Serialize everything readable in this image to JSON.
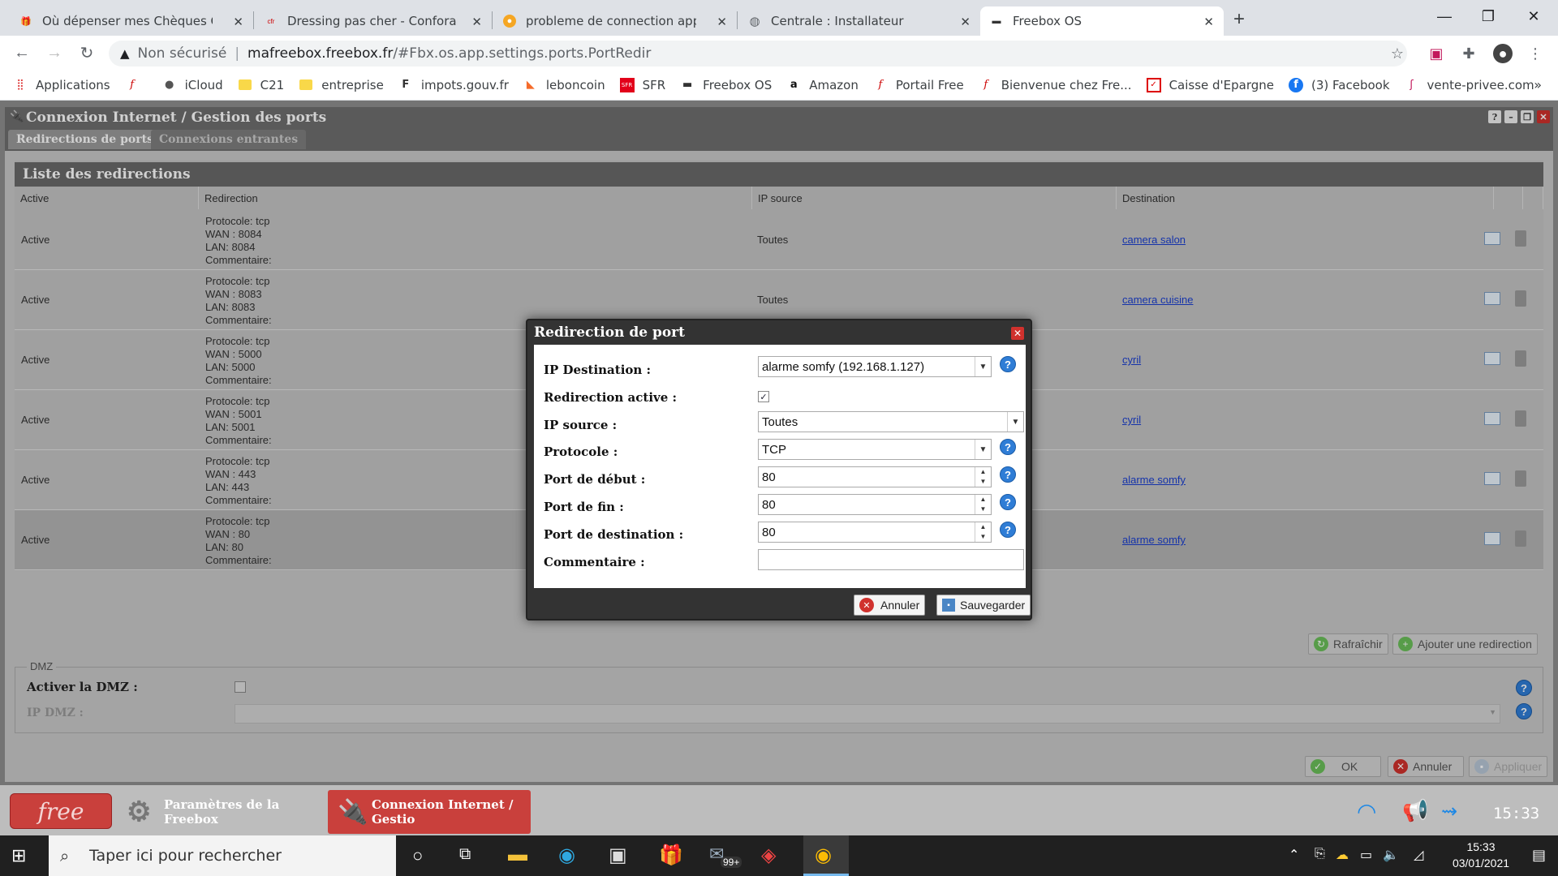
{
  "browser": {
    "tabs": [
      {
        "title": "Où dépenser mes Chèques Cade",
        "icon": "gift-icon"
      },
      {
        "title": "Dressing pas cher - Conforama –",
        "icon": "conforama-icon"
      },
      {
        "title": "probleme de connection applicat",
        "icon": "forum-icon"
      },
      {
        "title": "Centrale  : Installateur",
        "icon": "globe-icon"
      },
      {
        "title": "Freebox OS",
        "icon": "freebox-icon"
      }
    ],
    "address": {
      "security": "Non sécurisé",
      "host": "mafreebox.freebox.fr",
      "path": "/#Fbx.os.app.settings.ports.PortRedir"
    },
    "bookmarks": [
      "Applications",
      "iCloud",
      "C21",
      "entreprise",
      "impots.gouv.fr",
      "leboncoin",
      "SFR",
      "Freebox OS",
      "Amazon",
      "Portail Free",
      "Bienvenue chez Fre...",
      "Caisse d'Epargne",
      "(3) Facebook",
      "vente-privee.com"
    ],
    "more": "»"
  },
  "window": {
    "title": "Connexion Internet / Gestion des ports",
    "subtabs": [
      "Redirections de ports",
      "Connexions entrantes"
    ]
  },
  "list": {
    "title": "Liste des redirections",
    "columns": [
      "Active",
      "Redirection",
      "IP source",
      "Destination"
    ],
    "rows": [
      {
        "active": "Active",
        "proto": "Protocole: tcp",
        "wan": "WAN : 8084",
        "lan": "LAN: 8084",
        "comment": "Commentaire:",
        "src": "Toutes",
        "dest": "camera salon"
      },
      {
        "active": "Active",
        "proto": "Protocole: tcp",
        "wan": "WAN : 8083",
        "lan": "LAN: 8083",
        "comment": "Commentaire:",
        "src": "Toutes",
        "dest": "camera cuisine"
      },
      {
        "active": "Active",
        "proto": "Protocole: tcp",
        "wan": "WAN : 5000",
        "lan": "LAN: 5000",
        "comment": "Commentaire:",
        "src": "",
        "dest": "cyril"
      },
      {
        "active": "Active",
        "proto": "Protocole: tcp",
        "wan": "WAN : 5001",
        "lan": "LAN: 5001",
        "comment": "Commentaire:",
        "src": "",
        "dest": "cyril"
      },
      {
        "active": "Active",
        "proto": "Protocole: tcp",
        "wan": "WAN : 443",
        "lan": "LAN: 443",
        "comment": "Commentaire:",
        "src": "",
        "dest": "alarme somfy"
      },
      {
        "active": "Active",
        "proto": "Protocole: tcp",
        "wan": "WAN : 80",
        "lan": "LAN: 80",
        "comment": "Commentaire:",
        "src": "",
        "dest": "alarme somfy"
      }
    ],
    "refresh": "Rafraîchir",
    "add": "Ajouter une redirection"
  },
  "dmz": {
    "legend": "DMZ",
    "enable_label": "Activer la DMZ :",
    "ip_label": "IP DMZ :"
  },
  "footer": {
    "ok": "OK",
    "cancel": "Annuler",
    "apply": "Appliquer"
  },
  "dialog": {
    "title": "Redirection de port",
    "ip_dest_label": "IP Destination :",
    "ip_dest_value": "alarme somfy (192.168.1.127)",
    "active_label": "Redirection active :",
    "active_checked": true,
    "ip_src_label": "IP source :",
    "ip_src_value": "Toutes",
    "proto_label": "Protocole :",
    "proto_value": "TCP",
    "port_start_label": "Port de début :",
    "port_start_value": "80",
    "port_end_label": "Port de fin :",
    "port_end_value": "80",
    "port_dest_label": "Port de destination :",
    "port_dest_value": "80",
    "comment_label": "Commentaire :",
    "comment_value": "",
    "cancel": "Annuler",
    "save": "Sauvegarder"
  },
  "freebox_taskbar": {
    "logo": "free",
    "items": [
      "Paramètres de la Freebox",
      "Connexion Internet / Gestio"
    ],
    "clock": "15:33"
  },
  "windows": {
    "search_placeholder": "Taper ici pour rechercher",
    "time": "15:33",
    "date": "03/01/2021",
    "mail_badge": "99+"
  },
  "colors": {
    "accent_red": "#d0312d",
    "help_blue": "#2f7dd6",
    "link_blue": "#1a3fd0"
  }
}
